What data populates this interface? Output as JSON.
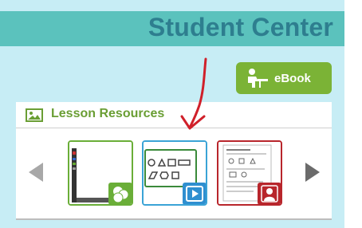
{
  "header": {
    "title": "Student Center"
  },
  "ebook_button": {
    "label": "eBook",
    "icon": "reader-icon"
  },
  "lesson_resources": {
    "title": "Lesson Resources",
    "icon": "image-icon",
    "items": [
      {
        "type": "whiteboard",
        "badge_icon": "shapes-icon",
        "color": "#6aae38"
      },
      {
        "type": "video",
        "badge_icon": "play-icon",
        "color": "#2f8fd0"
      },
      {
        "type": "worksheet",
        "badge_icon": "person-icon",
        "color": "#b8262c"
      }
    ],
    "prev_icon": "chevron-left-icon",
    "next_icon": "chevron-right-icon"
  },
  "colors": {
    "banner": "#5bc2bd",
    "title_text": "#2e7e8f",
    "page_bg": "#c7edf5",
    "accent_green": "#7bb336",
    "annotation_red": "#d0202a"
  }
}
